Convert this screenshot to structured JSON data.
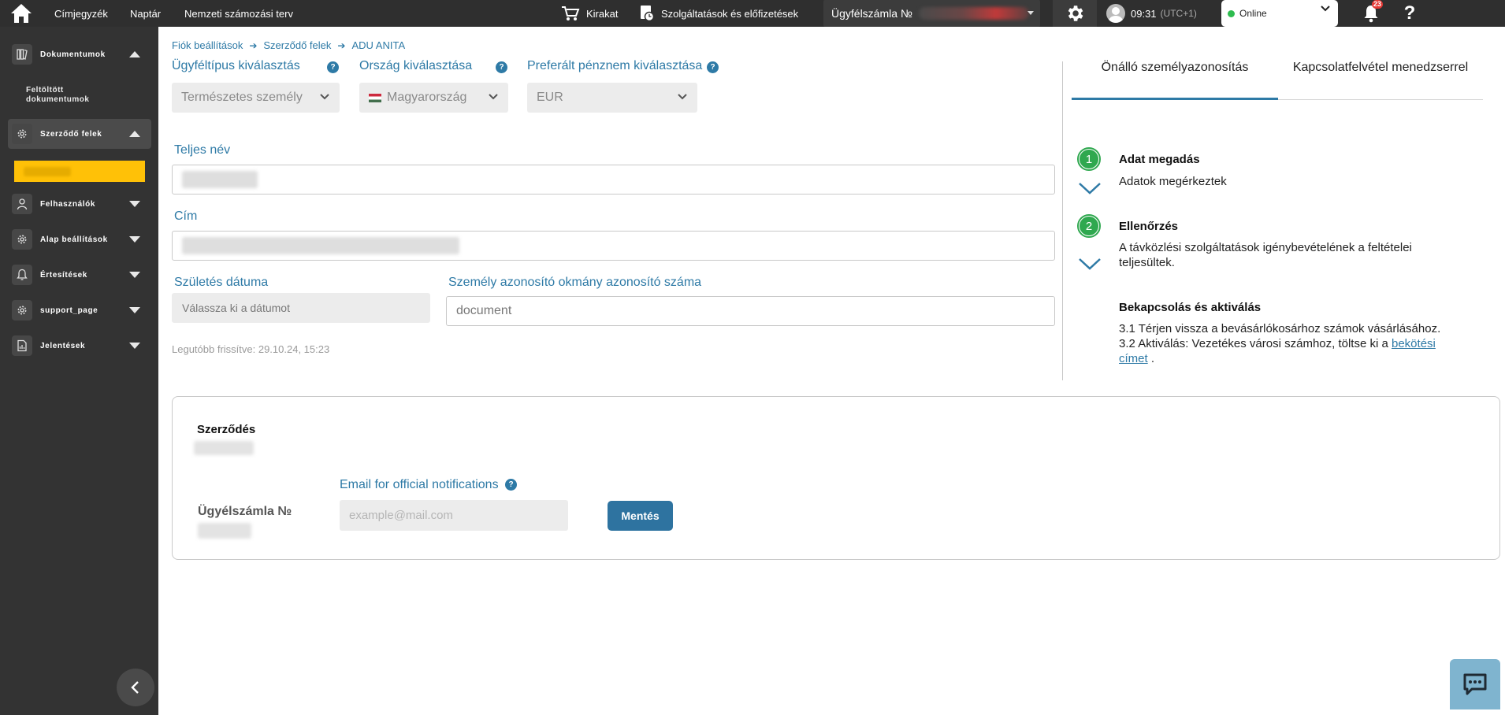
{
  "topbar": {
    "address_book": "Címjegyzék",
    "calendar": "Naptár",
    "numbering_plan": "Nemzeti számozási terv",
    "shop": "Kirakat",
    "services": "Szolgáltatások és előfizetések",
    "account_label": "Ügyfélszámla №",
    "time": "09:31",
    "timezone": "(UTC+1)",
    "status": "Online",
    "status_color": "#2ebc4f",
    "notifications_count": "23",
    "help": "?"
  },
  "sidebar": {
    "documents": "Dokumentumok",
    "uploaded_docs": "Feltöltött dokumentumok",
    "contract_parties": "Szerződő felek",
    "users": "Felhasználók",
    "base_settings": "Alap beállítások",
    "notifications": "Értesítések",
    "support": "support_page",
    "reports": "Jelentések",
    "highlight_color": "#ffc107"
  },
  "breadcrumb": {
    "items": [
      "Fiók beállítások",
      "Szerződő felek",
      "ADU ANITA"
    ]
  },
  "form": {
    "client_type_label": "Ügyféltípus kiválasztás",
    "client_type_value": "Természetes személy",
    "country_label": "Ország kiválasztása",
    "country_value": "Magyarország",
    "currency_label": "Preferált pénznem kiválasztása",
    "currency_value": "EUR",
    "full_name_label": "Teljes név",
    "address_label": "Cím",
    "birth_date_label": "Születés dátuma",
    "birth_date_placeholder": "Válassza ki a dátumot",
    "id_doc_label": "Személy azonosító okmány azonosító száma",
    "id_doc_placeholder": "document",
    "last_updated": "Legutóbb frissítve: 29.10.24, 15:23",
    "help_mark": "?"
  },
  "right_panel": {
    "tab_self": "Önálló személyazonosítás",
    "tab_manager": "Kapcsolatfelvétel menedzserrel",
    "step1_number": "1",
    "step1_title": "Adat megadás",
    "step1_text": "Adatok megérkeztek",
    "step2_number": "2",
    "step2_title": "Ellenőrzés",
    "step2_text": "A távközlési szolgáltatások igénybevételének a feltételei teljesültek.",
    "step3_title": "Bekapcsolás és aktiválás",
    "step3_line1": "3.1 Térjen vissza a bevásárlókosárhoz számok vásárlásához.",
    "step3_line2_prefix": "3.2 Aktiválás: Vezetékes városi számhoz, töltse ki a ",
    "step3_link": "bekötési címet",
    "step3_suffix": " .",
    "accent_color": "#2e7aa6",
    "step_color": "#2fa84f"
  },
  "contract": {
    "title": "Szerződés",
    "account_label": "Ügyélszámla №",
    "email_label": "Email for official notifications",
    "email_placeholder": "example@mail.com",
    "save_label": "Mentés",
    "help_mark": "?"
  }
}
